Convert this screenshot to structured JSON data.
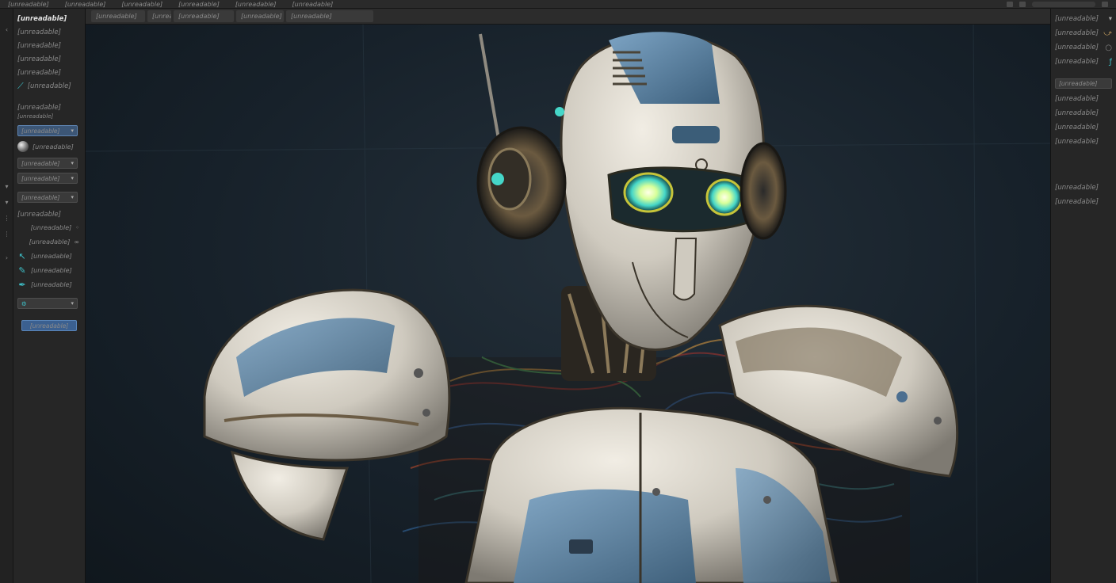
{
  "ui": {
    "unreadable": "[unreadable]",
    "accent_color": "#3b6090",
    "highlight_color": "#3ec0c8"
  },
  "menubar": {
    "items": [
      "[unreadable]",
      "[unreadable]",
      "[unreadable]",
      "[unreadable]",
      "[unreadable]",
      "[unreadable]"
    ]
  },
  "tabbar": {
    "tabs": [
      "[unreadable]",
      "[unreadable]",
      "[unreadable]",
      "[unreadable]",
      "[unreadable]"
    ]
  },
  "left_panel": {
    "title": "[unreadable]",
    "items": [
      "[unreadable]",
      "[unreadable]",
      "[unreadable]",
      "[unreadable]",
      "[unreadable]"
    ],
    "section": "[unreadable]",
    "section_sub": "[unreadable]",
    "selects": [
      "[unreadable]",
      "[unreadable]",
      "[unreadable]",
      "[unreadable]"
    ],
    "tools": [
      "[unreadable]",
      "[unreadable]",
      "[unreadable]",
      "[unreadable]",
      "[unreadable]",
      "[unreadable]",
      "[unreadable]"
    ],
    "button": "[unreadable]"
  },
  "right_panel": {
    "items": [
      "[unreadable]",
      "[unreadable]",
      "[unreadable]",
      "[unreadable]"
    ],
    "header": "[unreadable]",
    "items2": [
      "[unreadable]",
      "[unreadable]",
      "[unreadable]",
      "[unreadable]"
    ],
    "items3": [
      "[unreadable]",
      "[unreadable]"
    ]
  },
  "viewport": {
    "subject_icon": "robot-render"
  }
}
